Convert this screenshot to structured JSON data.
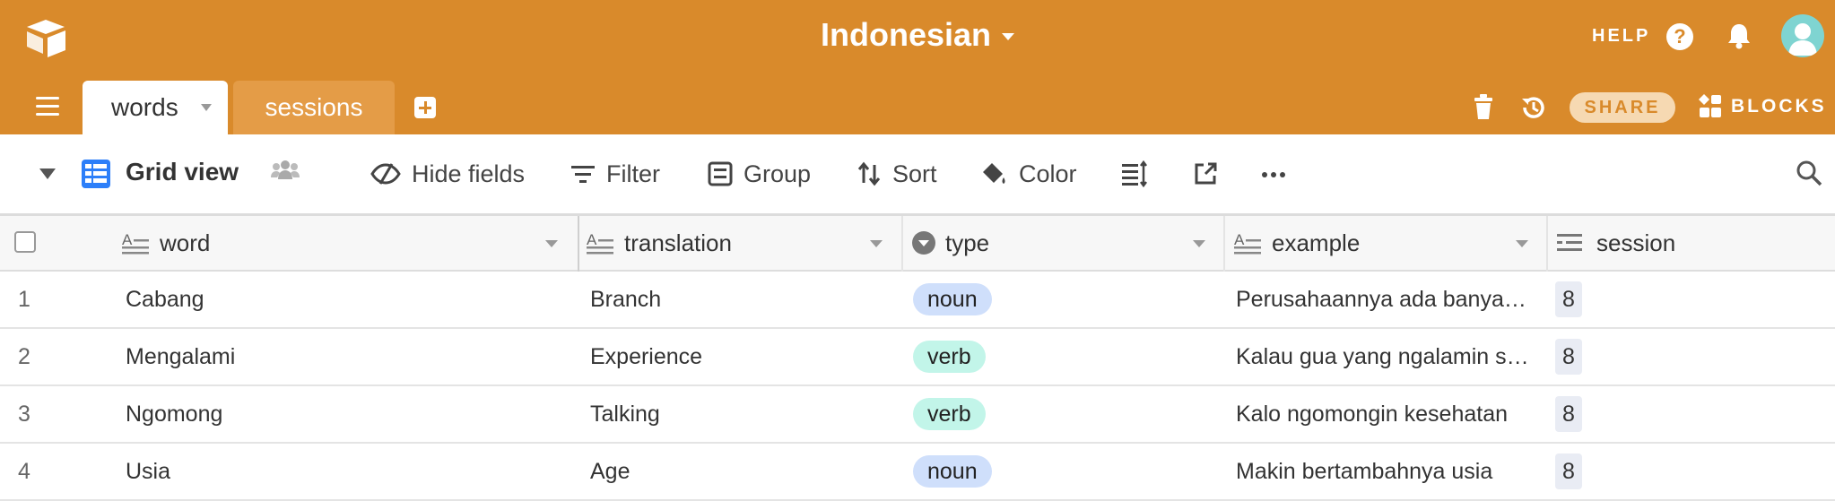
{
  "header": {
    "base_title": "Indonesian",
    "help_label": "HELP",
    "share_label": "SHARE",
    "blocks_label": "BLOCKS"
  },
  "tabs": [
    {
      "label": "words",
      "active": true
    },
    {
      "label": "sessions",
      "active": false
    }
  ],
  "toolbar": {
    "view_name": "Grid view",
    "hide_fields": "Hide fields",
    "filter": "Filter",
    "group": "Group",
    "sort": "Sort",
    "color": "Color"
  },
  "columns": [
    {
      "label": "word",
      "field_type": "single-line-text"
    },
    {
      "label": "translation",
      "field_type": "single-line-text"
    },
    {
      "label": "type",
      "field_type": "single-select"
    },
    {
      "label": "example",
      "field_type": "long-text"
    },
    {
      "label": "session",
      "field_type": "linked-record"
    }
  ],
  "rows": [
    {
      "num": "1",
      "word": "Cabang",
      "translation": "Branch",
      "type": "noun",
      "example": "Perusahaannya ada banyak cabang",
      "session": "8"
    },
    {
      "num": "2",
      "word": "Mengalami",
      "translation": "Experience",
      "type": "verb",
      "example": "Kalau gua yang ngalamin sendiri",
      "session": "8"
    },
    {
      "num": "3",
      "word": "Ngomong",
      "translation": "Talking",
      "type": "verb",
      "example": "Kalo ngomongin kesehatan",
      "session": "8"
    },
    {
      "num": "4",
      "word": "Usia",
      "translation": "Age",
      "type": "noun",
      "example": "Makin bertambahnya usia",
      "session": "8"
    }
  ],
  "colors": {
    "brand_orange": "#d98a2b",
    "noun_pill": "#cfdffb",
    "verb_pill": "#c2f5e9"
  }
}
